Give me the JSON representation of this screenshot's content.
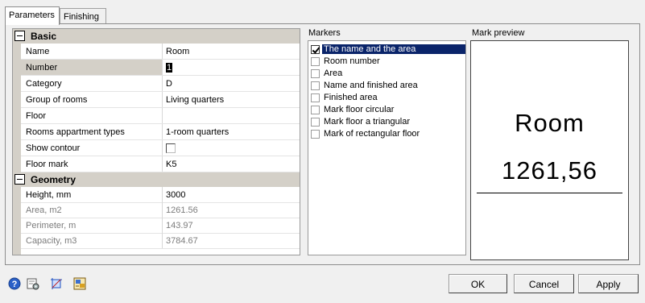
{
  "tabs": {
    "parameters": "Parameters",
    "finishing": "Finishing"
  },
  "grid": {
    "basic_title": "Basic",
    "basic_rows": [
      {
        "name": "Name",
        "value": "Room"
      },
      {
        "name": "Number",
        "value": "1"
      },
      {
        "name": "Category",
        "value": "D"
      },
      {
        "name": "Group of rooms",
        "value": "Living quarters"
      },
      {
        "name": "Floor",
        "value": ""
      },
      {
        "name": "Rooms appartment types",
        "value": "1-room quarters"
      },
      {
        "name": "Show contour",
        "value": false
      },
      {
        "name": "Floor mark",
        "value": "K5"
      }
    ],
    "geometry_title": "Geometry",
    "geometry_rows": [
      {
        "name": "Height, mm",
        "value": "3000"
      },
      {
        "name": "Area, m2",
        "value": "1261.56"
      },
      {
        "name": "Perimeter, m",
        "value": "143.97"
      },
      {
        "name": "Capacity, m3",
        "value": "3784.67"
      }
    ]
  },
  "markers": {
    "title": "Markers",
    "items": [
      {
        "label": "The name and the area",
        "checked": true
      },
      {
        "label": "Room number",
        "checked": false
      },
      {
        "label": "Area",
        "checked": false
      },
      {
        "label": "Name and finished area",
        "checked": false
      },
      {
        "label": "Finished area",
        "checked": false
      },
      {
        "label": "Mark floor circular",
        "checked": false
      },
      {
        "label": "Mark floor a triangular",
        "checked": false
      },
      {
        "label": "Mark of rectangular floor",
        "checked": false
      }
    ]
  },
  "preview": {
    "title": "Mark preview",
    "name": "Room",
    "area": "1261,56"
  },
  "buttons": {
    "ok": "OK",
    "cancel": "Cancel",
    "apply": "Apply"
  },
  "colors": {
    "selection": "#0a246a",
    "category_bg": "#d4d0c8",
    "help_icon": "#2a60c8"
  },
  "icons": [
    "help-icon",
    "settings-icon",
    "crop-icon",
    "image-icon"
  ]
}
